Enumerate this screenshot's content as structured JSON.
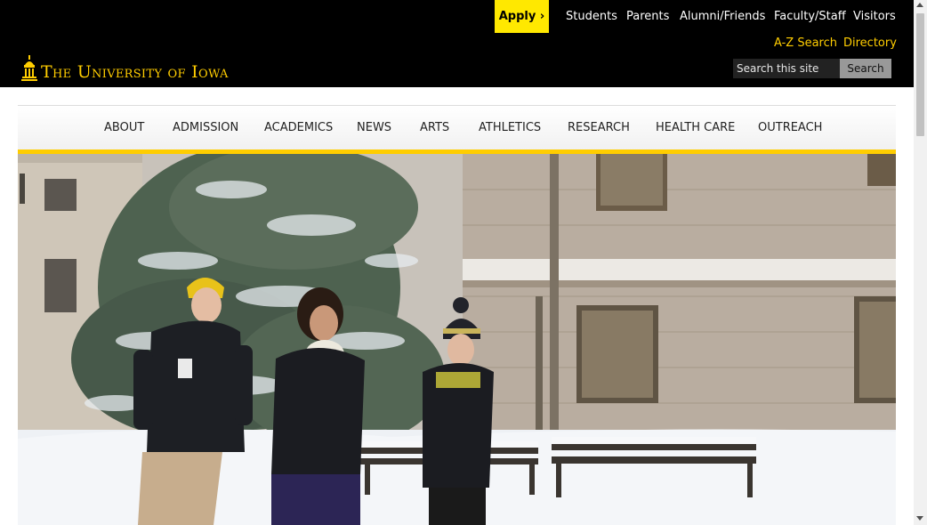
{
  "header": {
    "logo_text": "The University of Iowa",
    "apply_label": "Apply ›",
    "audience_links": [
      "Students",
      "Parents",
      "Alumni/Friends",
      "Faculty/Staff",
      "Visitors"
    ],
    "utility_links": [
      "A-Z Search",
      "Directory"
    ],
    "search": {
      "placeholder": "Search this site",
      "button_label": "Search"
    }
  },
  "main_nav": {
    "items": [
      "ABOUT",
      "ADMISSION",
      "ACADEMICS",
      "NEWS",
      "ARTS",
      "ATHLETICS",
      "RESEARCH",
      "HEALTH CARE",
      "OUTREACH"
    ]
  },
  "hero": {
    "icon": "hero-photo-students-winter"
  },
  "colors": {
    "gold": "#FFCD00",
    "apply_yellow": "#FFE800",
    "black": "#000000"
  }
}
